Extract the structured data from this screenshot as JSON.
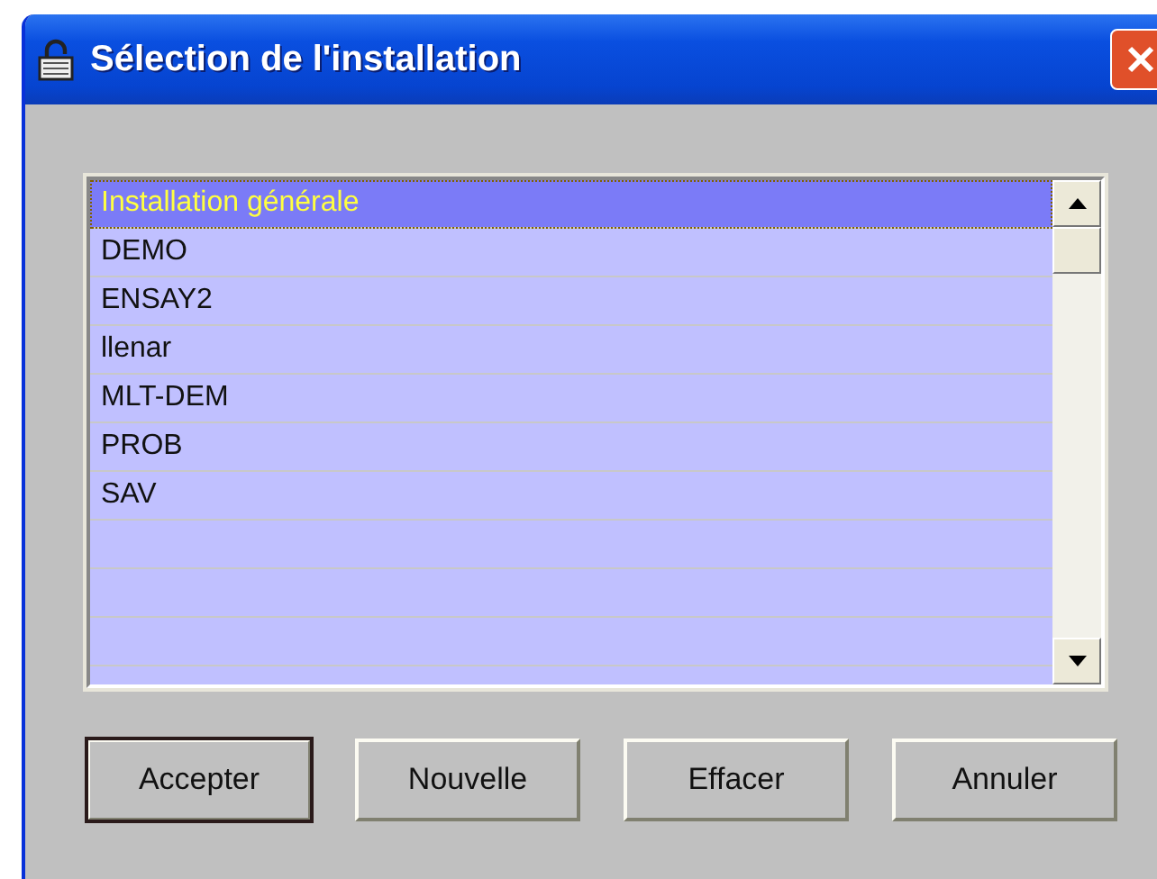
{
  "window": {
    "title": "Sélection de l'installation"
  },
  "list": {
    "items": [
      {
        "label": "Installation générale",
        "selected": true
      },
      {
        "label": "DEMO",
        "selected": false
      },
      {
        "label": "ENSAY2",
        "selected": false
      },
      {
        "label": "llenar",
        "selected": false
      },
      {
        "label": "MLT-DEM",
        "selected": false
      },
      {
        "label": "PROB",
        "selected": false
      },
      {
        "label": "SAV",
        "selected": false
      }
    ]
  },
  "buttons": [
    {
      "label": "Accepter",
      "default": true
    },
    {
      "label": "Nouvelle",
      "default": false
    },
    {
      "label": "Effacer",
      "default": false
    },
    {
      "label": "Annuler",
      "default": false
    }
  ]
}
